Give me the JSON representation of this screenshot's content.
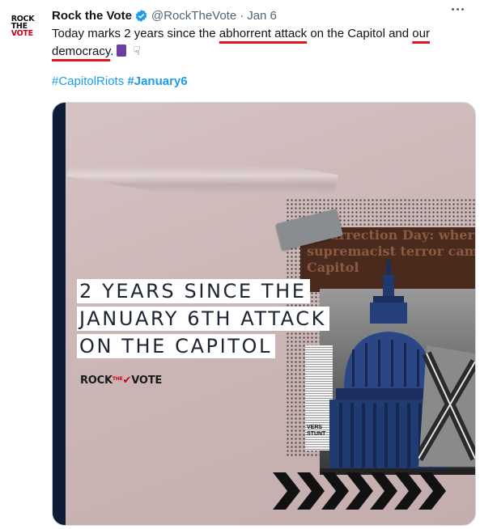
{
  "author": {
    "avatar_logo_lines": [
      "ROCK",
      "THE",
      "VOTE"
    ],
    "name": "Rock the Vote",
    "handle": "@RockTheVote",
    "separator": "·",
    "date": "Jan 6"
  },
  "tweet": {
    "text_segments": [
      "Today marks 2 years since the ",
      "abhorrent attack",
      " on the Capitol and ",
      "our",
      " ",
      "democracy",
      "."
    ],
    "hashtags": [
      "#CapitolRiots",
      "#January6"
    ]
  },
  "media": {
    "headline_lines": [
      "2 YEARS SINCE THE",
      "JANUARY 6TH ATTACK",
      "ON THE CAPITOL"
    ],
    "brand_text": [
      "ROCK",
      "THE",
      "VOTE"
    ],
    "newspaper_lines": [
      "Insurrection Day: wher",
      "supremacist terror cam",
      "Capitol"
    ],
    "clipping_text": [
      "VERS",
      "STUNT"
    ]
  },
  "icons": {
    "verified": "verified-badge-icon",
    "more": "more-options-icon"
  },
  "colors": {
    "link": "#1d9bf0",
    "annotation_underline": "#e0141e",
    "navy": "#0e1c36"
  }
}
